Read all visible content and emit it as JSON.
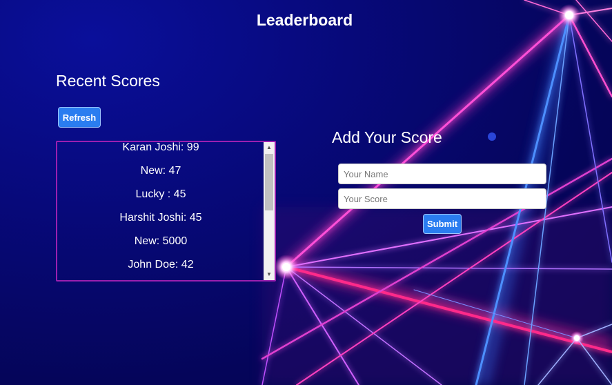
{
  "header": {
    "title": "Leaderboard"
  },
  "recent": {
    "title": "Recent Scores",
    "refresh_label": "Refresh",
    "scores": [
      "Karan Joshi: 99",
      "New: 47",
      "Lucky : 45",
      "Harshit Joshi: 45",
      "New: 5000",
      "John Doe: 42"
    ]
  },
  "add": {
    "title": "Add Your Score",
    "name_placeholder": "Your Name",
    "score_placeholder": "Your Score",
    "submit_label": "Submit"
  },
  "colors": {
    "button": "#2a7df0",
    "list_border": "#9b1fb0",
    "background": "#07097a",
    "laser_pink": "#ff3fd0",
    "laser_blue": "#4a8cff"
  }
}
